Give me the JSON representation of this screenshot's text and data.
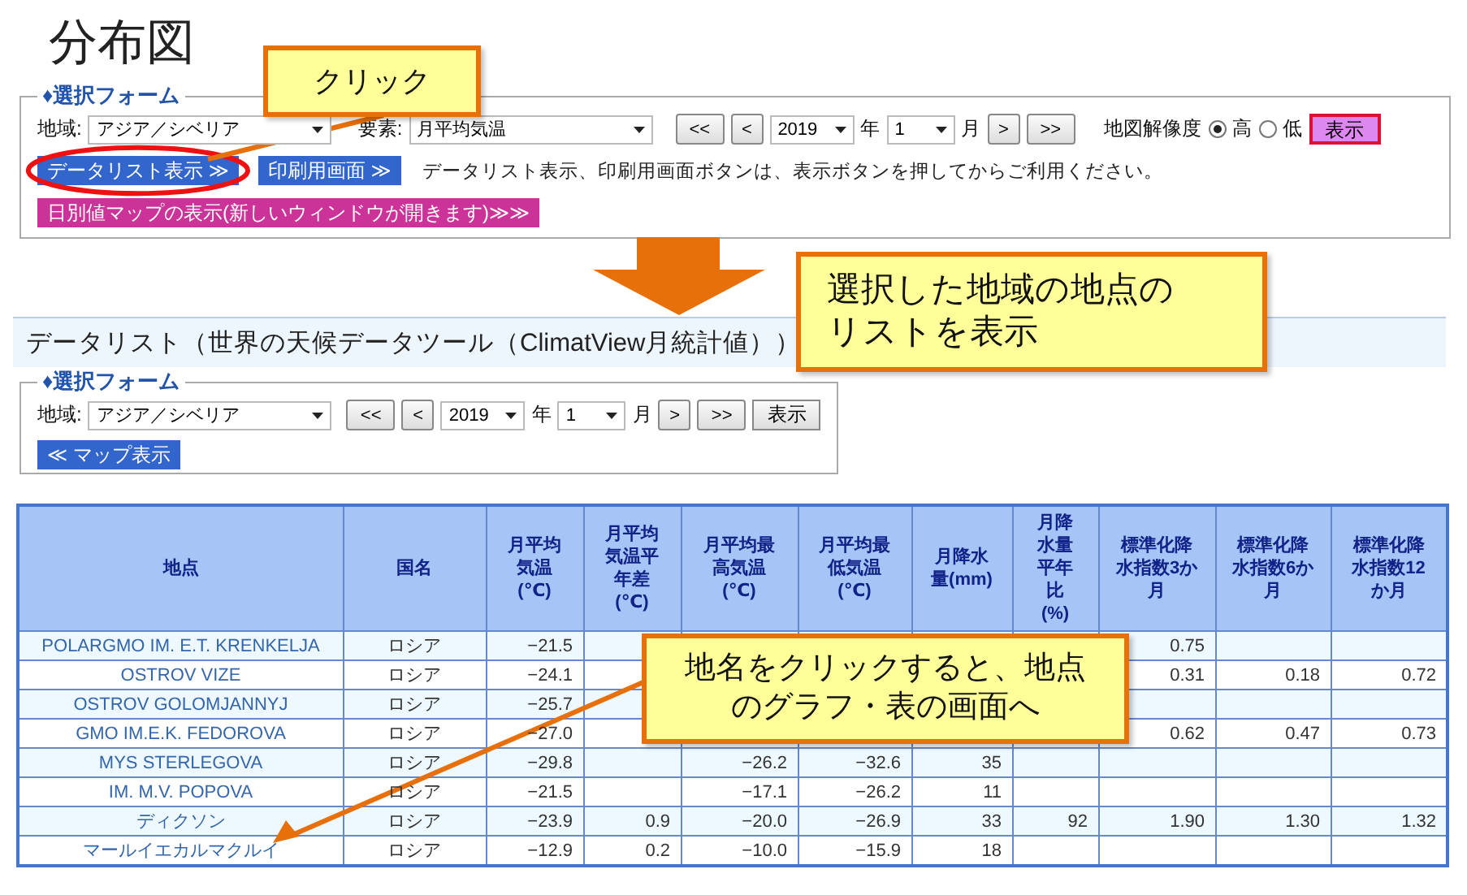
{
  "page_title": "分布図",
  "map_form": {
    "legend": "♦選択フォーム",
    "region_label": "地域:",
    "region": "アジア／シベリア",
    "element_label": "要素:",
    "element": "月平均気温",
    "prev_buttons": [
      "<<",
      "<"
    ],
    "year": "2019",
    "year_unit": "年",
    "month": "1",
    "month_unit": "月",
    "next_buttons": [
      ">",
      ">>"
    ],
    "resolution_label": "地図解像度",
    "resolution_options": [
      {
        "label": "高",
        "selected": true
      },
      {
        "label": "低",
        "selected": false
      }
    ],
    "show_button": "表示",
    "datalist_button": "データリスト表示 ≫",
    "print_button": "印刷用画面 ≫",
    "note": "データリスト表示、印刷用画面ボタンは、表示ボタンを押してからご利用ください。",
    "daily_map_button": "日別値マップの表示(新しいウィンドウが開きます)≫≫"
  },
  "datalist": {
    "title": "データリスト（世界の天候データツール（ClimatView月統計値））",
    "form": {
      "legend": "♦選択フォーム",
      "region_label": "地域:",
      "region": "アジア／シベリア",
      "prev_buttons": [
        "<<",
        "<"
      ],
      "year": "2019",
      "year_unit": "年",
      "month": "1",
      "month_unit": "月",
      "next_buttons": [
        ">",
        ">>"
      ],
      "show_button": "表示",
      "map_button": "≪ マップ表示"
    },
    "table": {
      "columns": [
        "地点",
        "国名",
        "月平均気温(℃)",
        "月平均気温平年差(℃)",
        "月平均最高気温(℃)",
        "月平均最低気温(℃)",
        "月降水量(mm)",
        "月降水量平年比(%)",
        "標準化降水指数3か月",
        "標準化降水指数6か月",
        "標準化降水指数12か月"
      ],
      "rows": [
        {
          "name": "POLARGMO IM. E.T. KRENKELJA",
          "country": "ロシア",
          "avg_temp": "−21.5",
          "spi_3": "0.75"
        },
        {
          "name": "OSTROV VIZE",
          "country": "ロシア",
          "avg_temp": "−24.1",
          "spi_3": "0.31",
          "spi_6": "0.18",
          "spi_12": "0.72"
        },
        {
          "name": "OSTROV GOLOMJANNYJ",
          "country": "ロシア",
          "avg_temp": "−25.7"
        },
        {
          "name": "GMO IM.E.K. FEDOROVA",
          "country": "ロシア",
          "avg_temp": "−27.0",
          "spi_3": "0.62",
          "spi_6": "0.47",
          "spi_12": "0.73"
        },
        {
          "name": "MYS STERLEGOVA",
          "country": "ロシア",
          "avg_temp": "−29.8",
          "avg_max": "−26.2",
          "avg_min": "−32.6",
          "precip": "35"
        },
        {
          "name": "IM. M.V. POPOVA",
          "country": "ロシア",
          "avg_temp": "−21.5",
          "avg_max": "−17.1",
          "avg_min": "−26.2",
          "precip": "11"
        },
        {
          "name": "ディクソン",
          "country": "ロシア",
          "avg_temp": "−23.9",
          "temp_anomaly": "0.9",
          "avg_max": "−20.0",
          "avg_min": "−26.9",
          "precip": "33",
          "precip_ratio": "92",
          "spi_3": "1.90",
          "spi_6": "1.30",
          "spi_12": "1.32"
        },
        {
          "name": "マールイエカルマクルイ",
          "country": "ロシア",
          "avg_temp": "−12.9",
          "temp_anomaly": "0.2",
          "avg_max": "−10.0",
          "avg_min": "−15.9",
          "precip": "18"
        }
      ]
    }
  },
  "annotations": [
    {
      "kind": "callout",
      "text": "クリック"
    },
    {
      "kind": "callout",
      "text": "選択した地域の地点のリストを表示"
    },
    {
      "kind": "callout",
      "text": "地名をクリックすると、地点のグラフ・表の画面へ"
    }
  ]
}
